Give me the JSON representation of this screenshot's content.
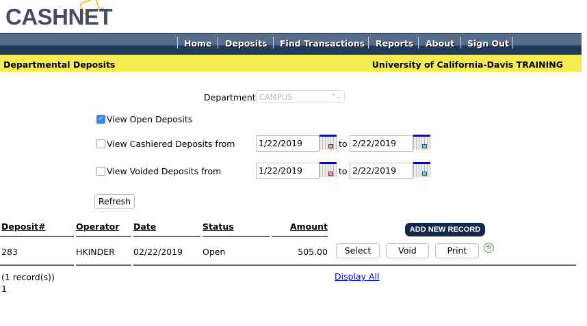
{
  "brand": {
    "logo": "CASHNET",
    "registered": "®"
  },
  "nav": {
    "items": [
      "Home",
      "Deposits",
      "Find Transactions",
      "Reports",
      "About",
      "Sign Out"
    ]
  },
  "header": {
    "page_title": "Departmental Deposits",
    "institution": "University of California-Davis TRAINING"
  },
  "form": {
    "department_label": "Department",
    "department_value": "CAMPUS",
    "view_open_label": "View Open Deposits",
    "view_open_checked": true,
    "view_cashiered_label": "View Cashiered Deposits from",
    "cashiered_from": "1/22/2019",
    "cashiered_to": "2/22/2019",
    "view_voided_label": "View Voided Deposits from",
    "voided_from": "1/22/2019",
    "voided_to": "2/22/2019",
    "to_label": "to",
    "refresh_label": "Refresh"
  },
  "table": {
    "headers": [
      "Deposit#",
      "Operator",
      "Date",
      "Status",
      "Amount"
    ],
    "add_new_label": "ADD NEW RECORD",
    "rows": [
      {
        "deposit": "283",
        "operator": "HKINDER",
        "date": "02/22/2019",
        "status": "Open",
        "amount": "505.00",
        "select": "Select",
        "void": "Void",
        "print": "Print"
      }
    ],
    "record_count": "(1 record(s))",
    "page": "1",
    "display_all": "Display All"
  }
}
